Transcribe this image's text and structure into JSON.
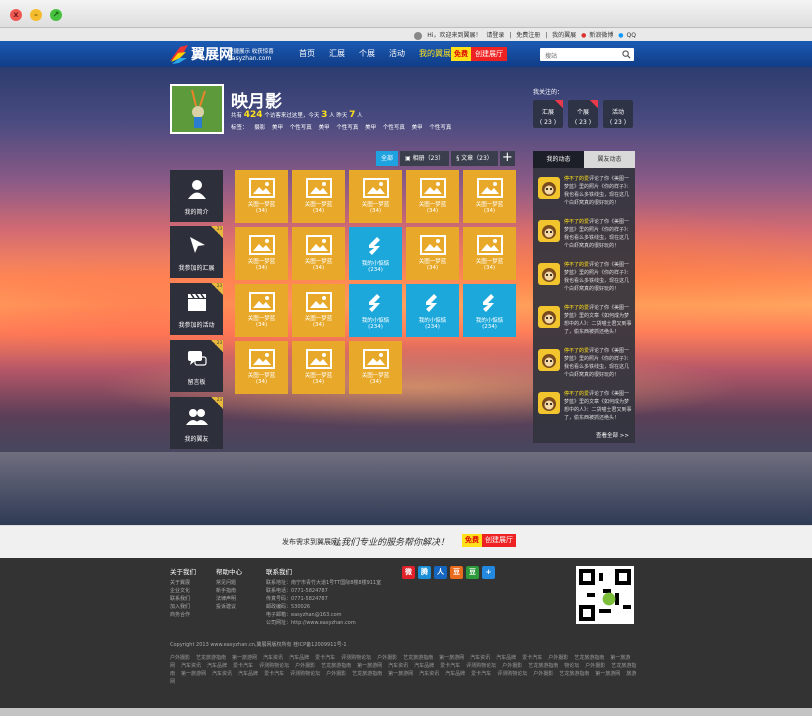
{
  "window": {
    "close": "x",
    "minimize": "–",
    "maximize": "↗"
  },
  "topbar": {
    "greeting": "Hi，欢迎来到翼展！",
    "login": "请登录",
    "register": "免费注册",
    "my_wing": "我的翼展",
    "weibo": "新浪微博",
    "qq": "QQ"
  },
  "nav": {
    "logo_cn": "翼展网",
    "logo_slogan": "便捷展示 收获惊喜",
    "logo_en": "Easyzhan.com",
    "items": [
      {
        "label": "首页",
        "active": false
      },
      {
        "label": "汇展",
        "active": false
      },
      {
        "label": "个展",
        "active": false
      },
      {
        "label": "活动",
        "active": false
      },
      {
        "label": "我的翼展",
        "active": true
      }
    ],
    "free_label": "免费",
    "create_label": "创建展厅",
    "search_placeholder": "搜站"
  },
  "profile": {
    "name": "映月影",
    "stats_prefix": "共有",
    "visits": "424",
    "stats_mid": "个访客来过这里，今天",
    "today": "3",
    "stats_mid2": "人  昨天",
    "yesterday": "7",
    "stats_suffix": "人",
    "tags_label": "标签：",
    "tags": [
      "摄影",
      "美甲",
      "个性写真",
      "美甲",
      "个性写真",
      "美甲",
      "个性写真",
      "美甲",
      "个性写真"
    ]
  },
  "following": {
    "title": "我关注的：",
    "items": [
      {
        "label": "汇展",
        "count": "( 23 )"
      },
      {
        "label": "个展",
        "count": "( 23 )"
      },
      {
        "label": "活动",
        "count": "( 23 )"
      }
    ]
  },
  "content_tabs": {
    "all": "全部",
    "album": "相册（23）",
    "article": "文章（23）",
    "add": "+"
  },
  "sidebar": [
    {
      "label": "我的简介",
      "count": ""
    },
    {
      "label": "我参加的汇展",
      "count": "23"
    },
    {
      "label": "我参加的活动",
      "count": "23"
    },
    {
      "label": "留言板",
      "count": "23"
    },
    {
      "label": "我的翼友",
      "count": "23"
    }
  ],
  "tiles": [
    {
      "type": "photo",
      "title": "关图一梦蓝",
      "count": "(34)"
    },
    {
      "type": "photo",
      "title": "关图一梦蓝",
      "count": "(34)"
    },
    {
      "type": "photo",
      "title": "关图一梦蓝",
      "count": "(34)"
    },
    {
      "type": "photo",
      "title": "关图一梦蓝",
      "count": "(34)"
    },
    {
      "type": "photo",
      "title": "关图一梦蓝",
      "count": "(34)"
    },
    {
      "type": "photo",
      "title": "关图一梦蓝",
      "count": "(34)"
    },
    {
      "type": "photo",
      "title": "关图一梦蓝",
      "count": "(34)"
    },
    {
      "type": "article",
      "title": "我的小惦惦",
      "count": "(234)"
    },
    {
      "type": "photo",
      "title": "关图一梦蓝",
      "count": "(34)"
    },
    {
      "type": "photo",
      "title": "关图一梦蓝",
      "count": "(34)"
    },
    {
      "type": "photo",
      "title": "关图一梦蓝",
      "count": "(34)"
    },
    {
      "type": "photo",
      "title": "关图一梦蓝",
      "count": "(34)"
    },
    {
      "type": "article",
      "title": "我的小惦惦",
      "count": "(234)"
    },
    {
      "type": "article",
      "title": "我的小惦惦",
      "count": "(234)"
    },
    {
      "type": "article",
      "title": "我的小惦惦",
      "count": "(234)"
    },
    {
      "type": "photo",
      "title": "关图一梦蓝",
      "count": "(34)"
    },
    {
      "type": "photo",
      "title": "关图一梦蓝",
      "count": "(34)"
    },
    {
      "type": "photo",
      "title": "关图一梦蓝",
      "count": "(34)"
    }
  ],
  "activity": {
    "tab_mine": "我的动态",
    "tab_friends": "翼友动态",
    "items": [
      {
        "user": "停不了的爱",
        "text": "评论了你《美图一梦蓝》里的照片《你的样子》：我也看么多铁线虫，现在这几个白虾窝真的很好玩的！"
      },
      {
        "user": "停不了的爱",
        "text": "评论了你《美图一梦蓝》里的照片《你的样子》：我也看么多铁线虫，现在这几个白虾窝真的很好玩的！"
      },
      {
        "user": "停不了的爱",
        "text": "评论了你《美图一梦蓝》里的照片《你的样子》：我也看么多铁线虫，现在这几个白虾窝真的很好玩的！"
      },
      {
        "user": "停不了的爱",
        "text": "评论了你《美图一梦蓝》里的文章《如何成为梦想中的人》：二货喵士君又到事了，偷东西被抓还绝头！"
      },
      {
        "user": "停不了的爱",
        "text": "评论了你《美图一梦蓝》里的照片《你的样子》：我也看么多铁线虫，现在这几个白虾窝真的很好玩的！"
      },
      {
        "user": "停不了的爱",
        "text": "评论了你《美图一梦蓝》里的文章《如何成为梦想中的人》：二货喵士君又到事了，偷东西被抓还绝头！"
      }
    ],
    "more": "查看全部 >>"
  },
  "slogan": {
    "prefix": "发布需求到翼展网，",
    "text": "让我们专业的服务帮你解决！",
    "free": "免费",
    "create": "创建展厅"
  },
  "footer": {
    "about_title": "关于我们",
    "about": [
      "关于翼展",
      "企业文化",
      "联系我们",
      "加入我们",
      "商务合作"
    ],
    "help_title": "帮助中心",
    "help": [
      "常见问题",
      "新手指南",
      "法律声明",
      "投诉建议"
    ],
    "contact_title": "联系我们",
    "contact": [
      "联系地址：南宁市青竹大道1号TT国际8楼8楼911室",
      "联系电话：0771-5824787",
      "传真号码：0771-5824787",
      "邮政编码：530026",
      "电子邮箱：easyzhan@163.com",
      "公司网址：http://www.easyzhan.com"
    ],
    "social": [
      "微",
      "腾",
      "人",
      "豆",
      "豆",
      "+"
    ],
    "copyright": "Copyright 2013 www.easyzhan.cn,翼展网版权所有  桂ICP备12009911号-1",
    "links": [
      "户外摄影",
      "艺龙旅游指南",
      "第一旅游网",
      "汽车资讯",
      "汽车品牌",
      "爱卡汽车",
      "评测购物论坛",
      "户外摄影",
      "艺龙旅游指南",
      "第一旅游网",
      "汽车资讯",
      "汽车品牌",
      "爱卡汽车",
      "户外摄影",
      "艺龙旅游指南",
      "第一旅游网",
      "汽车资讯",
      "汽车品牌",
      "爱卡汽车",
      "评测购物论坛",
      "户外摄影",
      "艺龙旅游指南",
      "第一旅游网",
      "汽车资讯",
      "汽车品牌",
      "爱卡汽车",
      "评测购物论坛",
      "户外摄影",
      "艺龙旅游指南",
      "物论坛",
      "户外摄影",
      "艺龙旅游指南",
      "第一旅游网",
      "汽车资讯",
      "汽车品牌",
      "爱卡汽车",
      "评测购物论坛",
      "户外摄影",
      "艺龙旅游指南",
      "第一旅游网",
      "汽车资讯",
      "汽车品牌",
      "爱卡汽车",
      "评测购物论坛",
      "户外摄影",
      "艺龙旅游指南",
      "第一旅游网",
      "旅游网"
    ]
  },
  "colors": {
    "accent_yellow": "#e8a82a",
    "accent_blue": "#1da8dc",
    "nav_blue": "#1b5bb4"
  }
}
